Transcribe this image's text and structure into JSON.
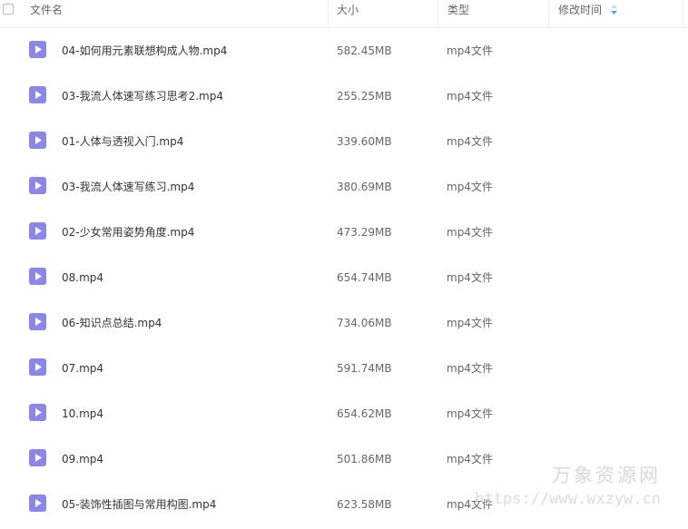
{
  "header": {
    "name_label": "文件名",
    "size_label": "大小",
    "type_label": "类型",
    "modified_label": "修改时间"
  },
  "files": [
    {
      "name": "04-如何用元素联想构成人物.mp4",
      "size": "582.45MB",
      "type": "mp4文件"
    },
    {
      "name": "03-我流人体速写练习思考2.mp4",
      "size": "255.25MB",
      "type": "mp4文件"
    },
    {
      "name": "01-人体与透视入门.mp4",
      "size": "339.60MB",
      "type": "mp4文件"
    },
    {
      "name": "03-我流人体速写练习.mp4",
      "size": "380.69MB",
      "type": "mp4文件"
    },
    {
      "name": "02-少女常用姿势角度.mp4",
      "size": "473.29MB",
      "type": "mp4文件"
    },
    {
      "name": "08.mp4",
      "size": "654.74MB",
      "type": "mp4文件"
    },
    {
      "name": "06-知识点总结.mp4",
      "size": "734.06MB",
      "type": "mp4文件"
    },
    {
      "name": "07.mp4",
      "size": "591.74MB",
      "type": "mp4文件"
    },
    {
      "name": "10.mp4",
      "size": "654.62MB",
      "type": "mp4文件"
    },
    {
      "name": "09.mp4",
      "size": "501.86MB",
      "type": "mp4文件"
    },
    {
      "name": "05-装饰性插图与常用构图.mp4",
      "size": "623.58MB",
      "type": "mp4文件"
    }
  ],
  "watermark": {
    "title": "万象资源网",
    "url": "https://www.wxzyw.cn"
  },
  "colors": {
    "video_icon": "#8a86ec",
    "sort_icon": "#4aa6f0"
  }
}
